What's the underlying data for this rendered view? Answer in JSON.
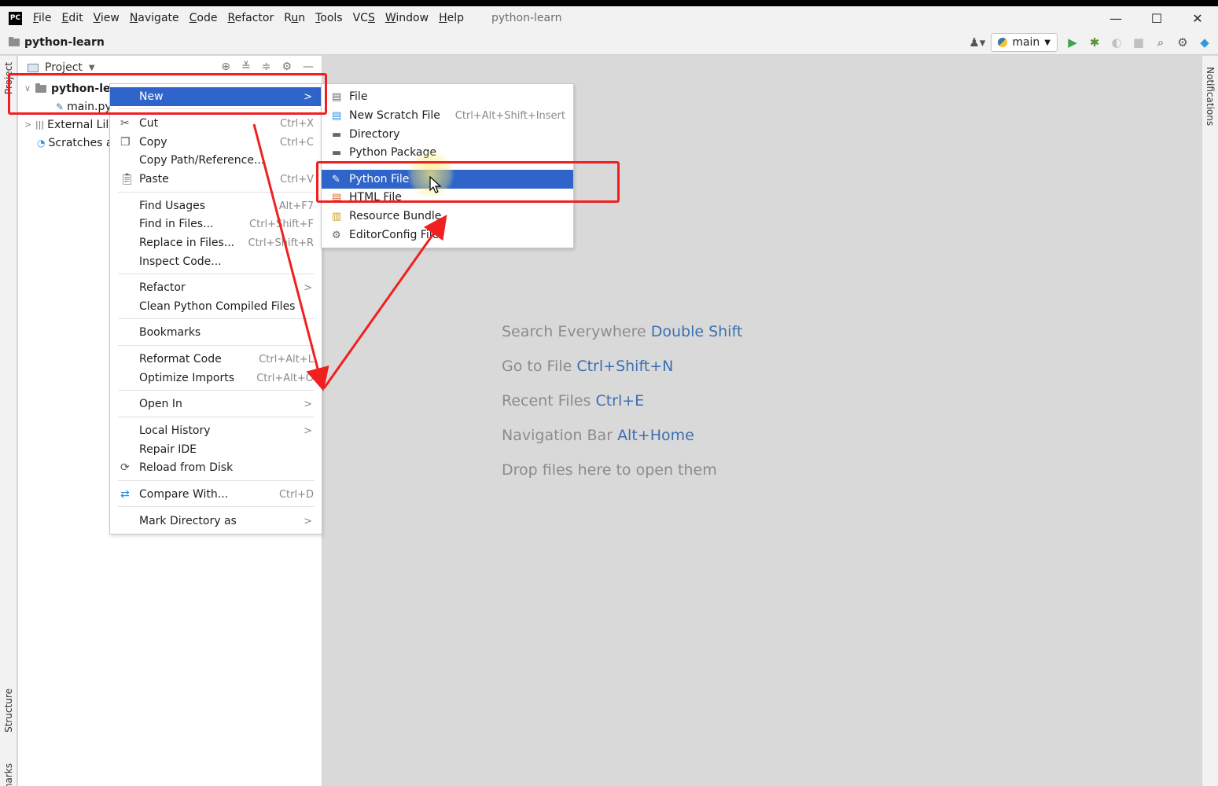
{
  "app": {
    "logo_text": "PC",
    "window_title": "python-learn",
    "menus": [
      {
        "pre": "",
        "u": "F",
        "post": "ile"
      },
      {
        "pre": "",
        "u": "E",
        "post": "dit"
      },
      {
        "pre": "",
        "u": "V",
        "post": "iew"
      },
      {
        "pre": "",
        "u": "N",
        "post": "avigate"
      },
      {
        "pre": "",
        "u": "C",
        "post": "ode"
      },
      {
        "pre": "",
        "u": "R",
        "post": "efactor"
      },
      {
        "pre": "R",
        "u": "u",
        "post": "n"
      },
      {
        "pre": "",
        "u": "T",
        "post": "ools"
      },
      {
        "pre": "VC",
        "u": "S",
        "post": ""
      },
      {
        "pre": "",
        "u": "W",
        "post": "indow"
      },
      {
        "pre": "",
        "u": "H",
        "post": "elp"
      }
    ],
    "window_controls": [
      "—",
      "☐",
      "✕"
    ]
  },
  "navbar": {
    "project_name": "python-learn",
    "run_config": "main"
  },
  "side_strips": {
    "left_top": "Project",
    "left_structure": "Structure",
    "left_bookmarks": "Bookmarks",
    "right_notifications": "Notifications"
  },
  "project_panel": {
    "title": "Project",
    "tree": {
      "root": "python-le",
      "main_file": "main.py",
      "external": "External Lil",
      "scratches": "Scratches a"
    }
  },
  "context_menu": {
    "items": [
      {
        "label": "New",
        "shortcut": "",
        "submenu": true
      },
      {
        "label": "Cut",
        "shortcut": "Ctrl+X"
      },
      {
        "label": "Copy",
        "shortcut": "Ctrl+C"
      },
      {
        "label": "Copy Path/Reference...",
        "shortcut": ""
      },
      {
        "label": "Paste",
        "shortcut": "Ctrl+V"
      },
      {
        "label": "Find Usages",
        "shortcut": "Alt+F7"
      },
      {
        "label": "Find in Files...",
        "shortcut": "Ctrl+Shift+F"
      },
      {
        "label": "Replace in Files...",
        "shortcut": "Ctrl+Shift+R"
      },
      {
        "label": "Inspect Code...",
        "shortcut": ""
      },
      {
        "label": "Refactor",
        "shortcut": "",
        "submenu": true
      },
      {
        "label": "Clean Python Compiled Files",
        "shortcut": ""
      },
      {
        "label": "Bookmarks",
        "shortcut": ""
      },
      {
        "label": "Reformat Code",
        "shortcut": "Ctrl+Alt+L"
      },
      {
        "label": "Optimize Imports",
        "shortcut": "Ctrl+Alt+O"
      },
      {
        "label": "Open In",
        "shortcut": "",
        "submenu": true
      },
      {
        "label": "Local History",
        "shortcut": "",
        "submenu": true
      },
      {
        "label": "Repair IDE",
        "shortcut": ""
      },
      {
        "label": "Reload from Disk",
        "shortcut": ""
      },
      {
        "label": "Compare With...",
        "shortcut": "Ctrl+D"
      },
      {
        "label": "Mark Directory as",
        "shortcut": "",
        "submenu": true
      }
    ]
  },
  "new_submenu": {
    "items": [
      {
        "label": "File",
        "shortcut": ""
      },
      {
        "label": "New Scratch File",
        "shortcut": "Ctrl+Alt+Shift+Insert"
      },
      {
        "label": "Directory",
        "shortcut": ""
      },
      {
        "label": "Python Package",
        "shortcut": ""
      },
      {
        "label": "Python File",
        "shortcut": ""
      },
      {
        "label": "HTML File",
        "shortcut": ""
      },
      {
        "label": "Resource Bundle",
        "shortcut": ""
      },
      {
        "label": "EditorConfig File",
        "shortcut": ""
      }
    ]
  },
  "editor_hints": [
    {
      "text": "Search Everywhere",
      "key": "Double Shift"
    },
    {
      "text": "Go to File",
      "key": "Ctrl+Shift+N"
    },
    {
      "text": "Recent Files",
      "key": "Ctrl+E"
    },
    {
      "text": "Navigation Bar",
      "key": "Alt+Home"
    },
    {
      "text": "Drop files here to open them",
      "key": ""
    }
  ],
  "colors": {
    "selection": "#2f65ca",
    "annotation_red": "#f02020",
    "hint_key": "#3c6fb0"
  }
}
